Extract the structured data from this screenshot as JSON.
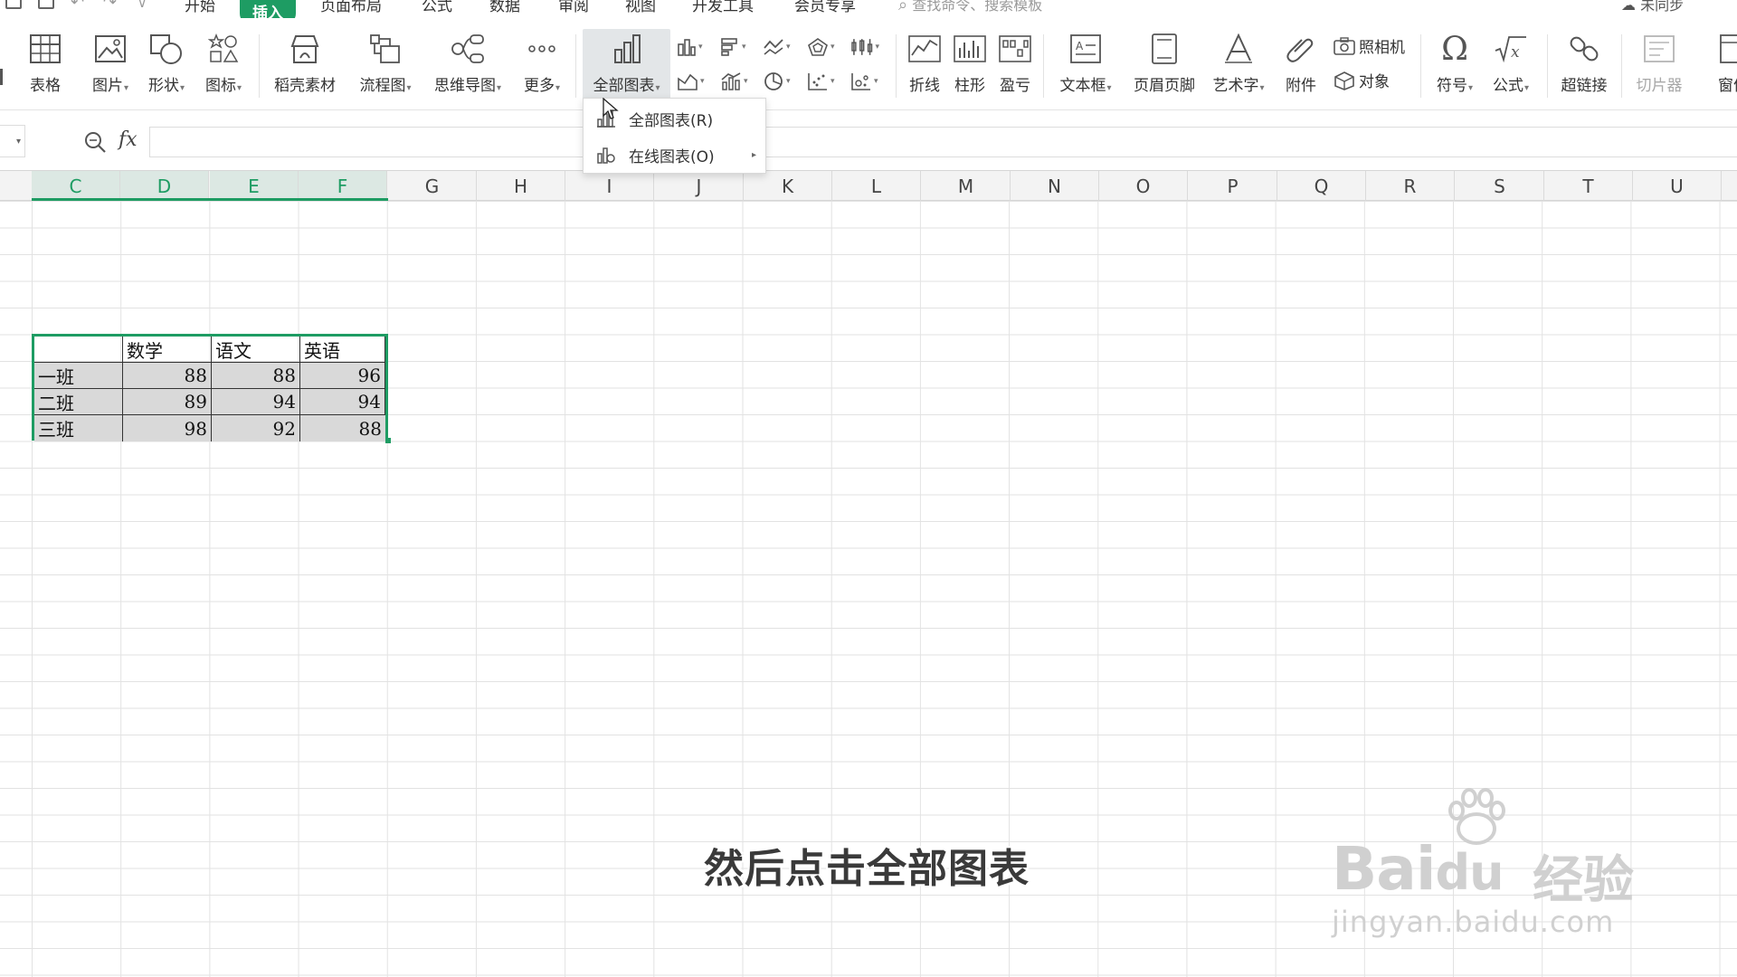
{
  "menu_tabs": [
    "开始",
    "插入",
    "页面布局",
    "公式",
    "数据",
    "审阅",
    "视图",
    "开发工具",
    "会员专享"
  ],
  "active_tab": "插入",
  "search": {
    "placeholder": "查找命令、搜索模板"
  },
  "sync": {
    "label": "未同步"
  },
  "ribbon": {
    "table": "表格",
    "picture": "图片",
    "shape": "形状",
    "icon": "图标",
    "daoke": "稻壳素材",
    "flowchart": "流程图",
    "mindmap": "思维导图",
    "more": "更多",
    "all_charts": "全部图表",
    "sparkline_line": "折线",
    "sparkline_column": "柱形",
    "sparkline_winloss": "盈亏",
    "textbox": "文本框",
    "header_footer": "页眉页脚",
    "wordart": "艺术字",
    "attachment": "附件",
    "camera": "照相机",
    "object": "对象",
    "symbol": "符号",
    "formula": "公式",
    "hyperlink": "超链接",
    "slicer": "切片器",
    "window": "窗体"
  },
  "dropdown": {
    "items": [
      {
        "label": "全部图表(R)",
        "has_submenu": false
      },
      {
        "label": "在线图表(O)",
        "has_submenu": true
      }
    ]
  },
  "formula_bar": {
    "fx": "fx",
    "value": ""
  },
  "columns": [
    "C",
    "D",
    "E",
    "F",
    "G",
    "H",
    "I",
    "J",
    "K",
    "L",
    "M",
    "N",
    "O",
    "P",
    "Q",
    "R",
    "S",
    "T",
    "U"
  ],
  "selected_columns": [
    "C",
    "D",
    "E",
    "F"
  ],
  "table": {
    "headers": [
      "",
      "数学",
      "语文",
      "英语"
    ],
    "rows": [
      [
        "一班",
        "88",
        "88",
        "96"
      ],
      [
        "二班",
        "89",
        "94",
        "94"
      ],
      [
        "三班",
        "98",
        "92",
        "88"
      ]
    ]
  },
  "subtitle": "然后点击全部图表",
  "watermark": {
    "brand": "Bai",
    "brand2": "du",
    "cn": "经验",
    "url": "jingyan.baidu.com"
  },
  "colors": {
    "accent": "#1e9c63",
    "selection_fill": "#d9d9d9"
  }
}
